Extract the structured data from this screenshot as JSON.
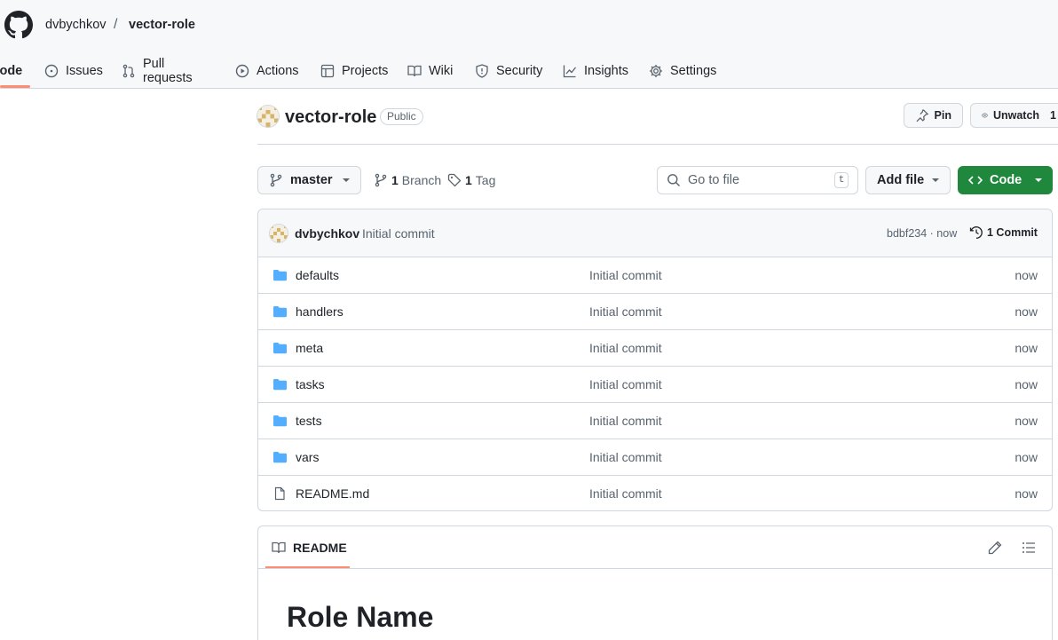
{
  "header": {
    "owner": "dvbychkov",
    "separator": "/",
    "repo": "vector-role",
    "tabs": [
      {
        "label": "Code",
        "icon": "code-icon",
        "selected": true
      },
      {
        "label": "Issues",
        "icon": "issue-icon"
      },
      {
        "label": "Pull requests",
        "icon": "pull-request-icon"
      },
      {
        "label": "Actions",
        "icon": "play-icon"
      },
      {
        "label": "Projects",
        "icon": "table-icon"
      },
      {
        "label": "Wiki",
        "icon": "book-icon"
      },
      {
        "label": "Security",
        "icon": "shield-icon"
      },
      {
        "label": "Insights",
        "icon": "graph-icon"
      },
      {
        "label": "Settings",
        "icon": "gear-icon"
      }
    ]
  },
  "repo_header": {
    "title": "vector-role",
    "visibility": "Public",
    "pin_label": "Pin",
    "unwatch_label": "Unwatch",
    "watch_count": "1"
  },
  "toolbar": {
    "branch": "master",
    "branch_count": "1",
    "branch_label": "Branch",
    "tag_count": "1",
    "tag_label": "Tag",
    "goto_placeholder": "Go to file",
    "goto_shortcut": "t",
    "add_file_label": "Add file",
    "code_label": "Code"
  },
  "latest_commit": {
    "author": "dvbychkov",
    "message": "Initial commit",
    "sha_time": "bdbf234 · now",
    "count_label": "1 Commit"
  },
  "files": [
    {
      "name": "defaults",
      "type": "dir",
      "message": "Initial commit",
      "age": "now"
    },
    {
      "name": "handlers",
      "type": "dir",
      "message": "Initial commit",
      "age": "now"
    },
    {
      "name": "meta",
      "type": "dir",
      "message": "Initial commit",
      "age": "now"
    },
    {
      "name": "tasks",
      "type": "dir",
      "message": "Initial commit",
      "age": "now"
    },
    {
      "name": "tests",
      "type": "dir",
      "message": "Initial commit",
      "age": "now"
    },
    {
      "name": "vars",
      "type": "dir",
      "message": "Initial commit",
      "age": "now"
    },
    {
      "name": "README.md",
      "type": "file",
      "message": "Initial commit",
      "age": "now"
    }
  ],
  "readme": {
    "tab_label": "README",
    "heading": "Role Name"
  },
  "colors": {
    "accent_underline": "#fd8c73",
    "primary_green": "#1f883d",
    "folder_blue": "#54aeff",
    "border": "#d0d7de",
    "muted_text": "#59636e"
  }
}
